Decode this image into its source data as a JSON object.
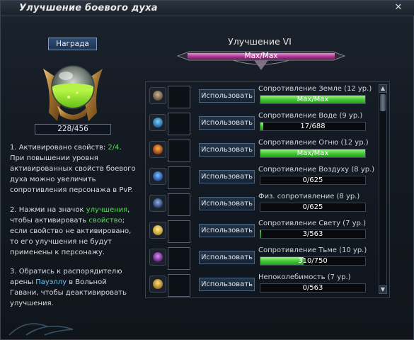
{
  "window": {
    "title": "Улучшение боевого духа",
    "close_glyph": "✕"
  },
  "left": {
    "reward_label": "Награда",
    "progress_text": "228/456",
    "progress": 0.5,
    "info": [
      {
        "t1": "1. Активировано свойств: ",
        "hl": "2/4",
        "t2": ". При повышении уровня активированных свойств боевого духа можно увеличить сопротивления персонажа в PvP."
      },
      {
        "t1": "2. Нажми на значок ",
        "hl": "улучшения",
        "t2": ", чтобы активировать ",
        "hl2": "свойство",
        "t3": "; если свойство не активировано, то его улучшения не будут применены к персонажу."
      },
      {
        "t1": "3. Обратись к распорядителю арены ",
        "lk": "Пауэллу",
        "t2": " в Вольной Гавани, чтобы деактивировать улучшения."
      }
    ]
  },
  "right": {
    "upgrade_title": "Улучшение VI",
    "max_bar_text": "Max/Max"
  },
  "rows": [
    {
      "icon": "earth-icon",
      "button": "Использовать",
      "name": "Сопротивление Земле (12 ур.)",
      "value": "Max/Max",
      "fill": 1.0
    },
    {
      "icon": "water-icon",
      "button": "Использовать",
      "name": "Сопротивление Воде (9 ур.)",
      "value": "17/688",
      "fill": 0.025
    },
    {
      "icon": "fire-icon",
      "button": "Использовать",
      "name": "Сопротивление Огню (12 ур.)",
      "value": "Max/Max",
      "fill": 1.0
    },
    {
      "icon": "wind-icon",
      "button": "Использовать",
      "name": "Сопротивление Воздуху (8 ур.)",
      "value": "0/625",
      "fill": 0
    },
    {
      "icon": "shield-icon",
      "button": "Использовать",
      "name": "Физ. сопротивление (8 ур.)",
      "value": "0/625",
      "fill": 0
    },
    {
      "icon": "light-icon",
      "button": "Использовать",
      "name": "Сопротивление Свету (7 ур.)",
      "value": "3/563",
      "fill": 0.005
    },
    {
      "icon": "dark-icon",
      "button": "Использовать",
      "name": "Сопротивление Тьме (10 ур.)",
      "value": "310/750",
      "fill": 0.413
    },
    {
      "icon": "sun-icon",
      "button": "Использовать",
      "name": "Непоколебимость (7 ур.)",
      "value": "0/563",
      "fill": 0
    }
  ],
  "colors": {
    "accent_green": "#58d85a",
    "link_blue": "#6fc4ee",
    "bar_green": "#3ec532"
  }
}
